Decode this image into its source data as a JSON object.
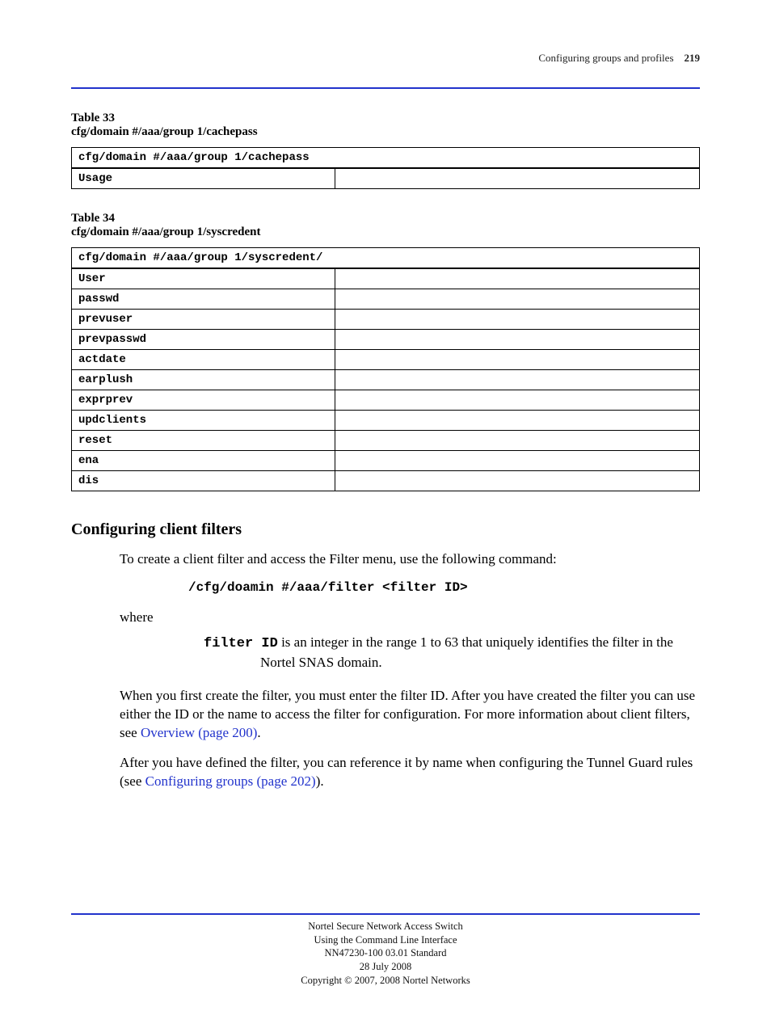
{
  "header": {
    "left": "",
    "right_line1": "Configuring groups and profiles",
    "right_line2": "219"
  },
  "table_a": {
    "title_head": "Table 33",
    "title_rest": "cfg/domain #/aaa/group 1/cachepass",
    "header_path": "cfg/domain #/aaa/group 1/cachepass",
    "rows": [
      {
        "left": "Usage",
        "right": ""
      }
    ]
  },
  "table_b": {
    "title_head": "Table 34",
    "title_rest": "cfg/domain #/aaa/group 1/syscredent",
    "header_path": "cfg/domain #/aaa/group 1/syscredent/",
    "rows": [
      {
        "left": "User",
        "right": ""
      },
      {
        "left": "passwd",
        "right": ""
      },
      {
        "left": "prevuser",
        "right": ""
      },
      {
        "left": "prevpasswd",
        "right": ""
      },
      {
        "left": "actdate",
        "right": ""
      },
      {
        "left": "earplush",
        "right": ""
      },
      {
        "left": "exprprev",
        "right": ""
      },
      {
        "left": "updclients",
        "right": ""
      },
      {
        "left": "reset",
        "right": ""
      },
      {
        "left": "ena",
        "right": ""
      },
      {
        "left": "dis",
        "right": ""
      }
    ]
  },
  "filters": {
    "heading": "Configuring client filters",
    "para1": "To create a client filter and access the Filter menu, use the following command:",
    "cmd": "/cfg/doamin #/aaa/filter <filter ID>",
    "where": "where",
    "term": "filter ID",
    "def_rest": " is an integer in the range 1 to 63 that uniquely identifies the filter in the Nortel SNAS domain.",
    "para2_a": "When you first create the filter, you must enter the filter ID. After you have created the filter you can use either the ID or the name to access the filter for configuration. For more information about client filters, see ",
    "para2_link": "Overview (page 200)",
    "para2_b": ".",
    "para3_a": "After you have defined the filter, you can reference it by name when configuring the Tunnel Guard rules (see ",
    "para3_link": "Configuring groups (page 202)",
    "para3_b": ")."
  },
  "footer": {
    "l1": "Nortel Secure Network Access Switch",
    "l2": "Using the Command Line Interface",
    "l3": "NN47230-100   03.01 Standard",
    "l4": "28 July 2008",
    "l5": "Copyright © 2007, 2008 Nortel Networks"
  }
}
